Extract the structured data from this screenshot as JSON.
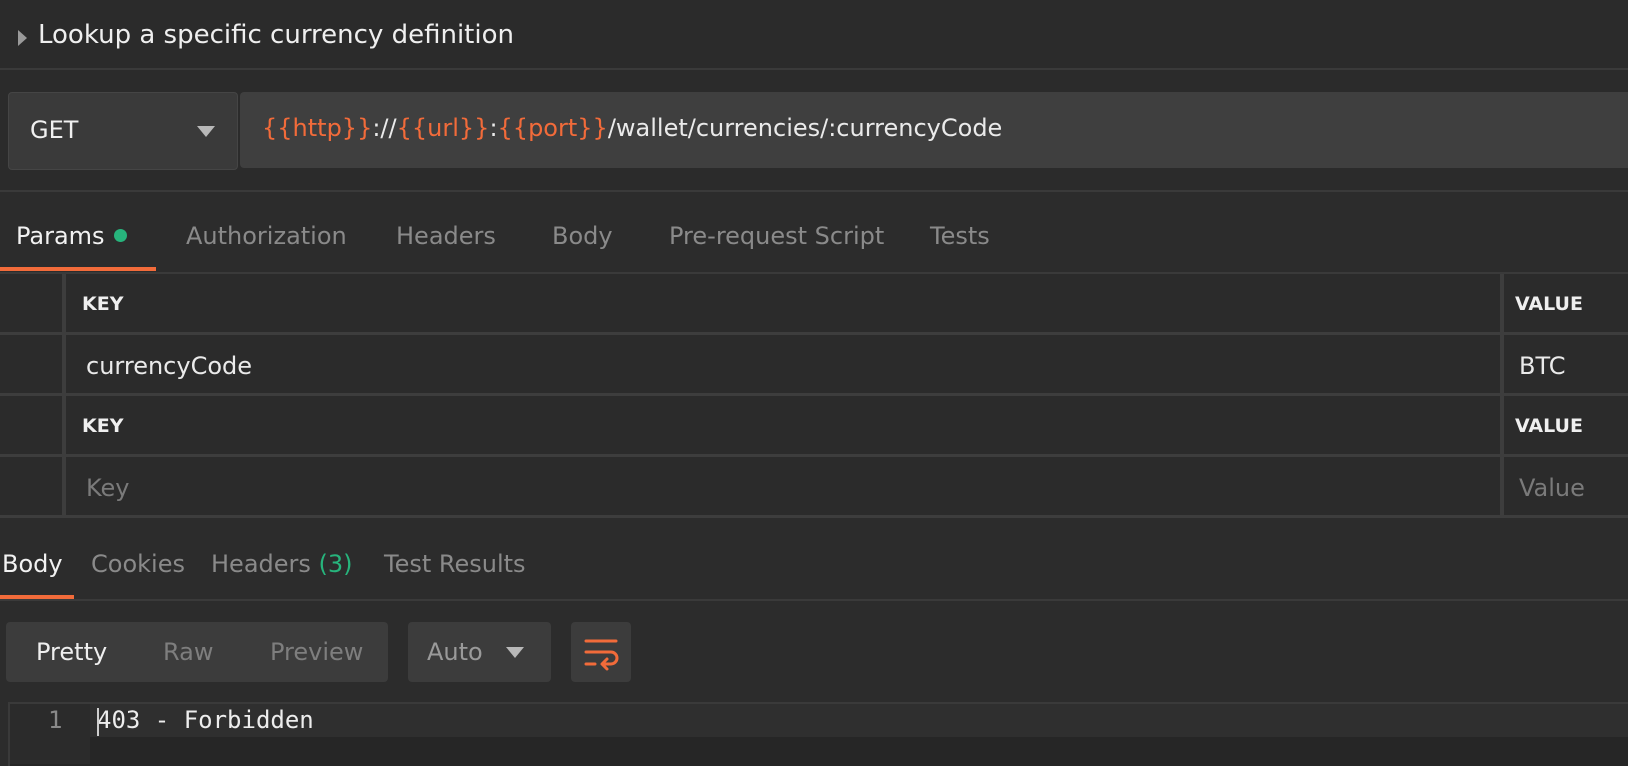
{
  "request": {
    "title": "Lookup a specific currency definition",
    "method": "GET",
    "url": {
      "var_http": "{{http}}",
      "sep1": "://",
      "var_url": "{{url}}",
      "sep2": ":",
      "var_port": "{{port}}",
      "path": "/wallet/currencies/:currencyCode"
    }
  },
  "request_tabs": [
    {
      "label": "Params",
      "active": true,
      "has_indicator": true
    },
    {
      "label": "Authorization",
      "active": false
    },
    {
      "label": "Headers",
      "active": false
    },
    {
      "label": "Body",
      "active": false
    },
    {
      "label": "Pre-request Script",
      "active": false
    },
    {
      "label": "Tests",
      "active": false
    }
  ],
  "path_variables": {
    "key_header": "KEY",
    "value_header": "VALUE",
    "rows": [
      {
        "key": "currencyCode",
        "value": "BTC"
      }
    ]
  },
  "query_params": {
    "key_header": "KEY",
    "value_header": "VALUE",
    "key_placeholder": "Key",
    "value_placeholder": "Value"
  },
  "response_tabs": {
    "body": "Body",
    "cookies": "Cookies",
    "headers": "Headers",
    "headers_count": "(3)",
    "test_results": "Test Results"
  },
  "format_bar": {
    "pretty": "Pretty",
    "raw": "Raw",
    "preview": "Preview",
    "language": "Auto"
  },
  "response_body": {
    "line_number": "1",
    "text": "403 - Forbidden"
  },
  "colors": {
    "accent": "#f26b3a",
    "indicator": "#27b47c"
  },
  "icons": {
    "expand": "caret-right-icon",
    "dropdown": "chevron-down-icon",
    "wrap": "word-wrap-icon"
  }
}
